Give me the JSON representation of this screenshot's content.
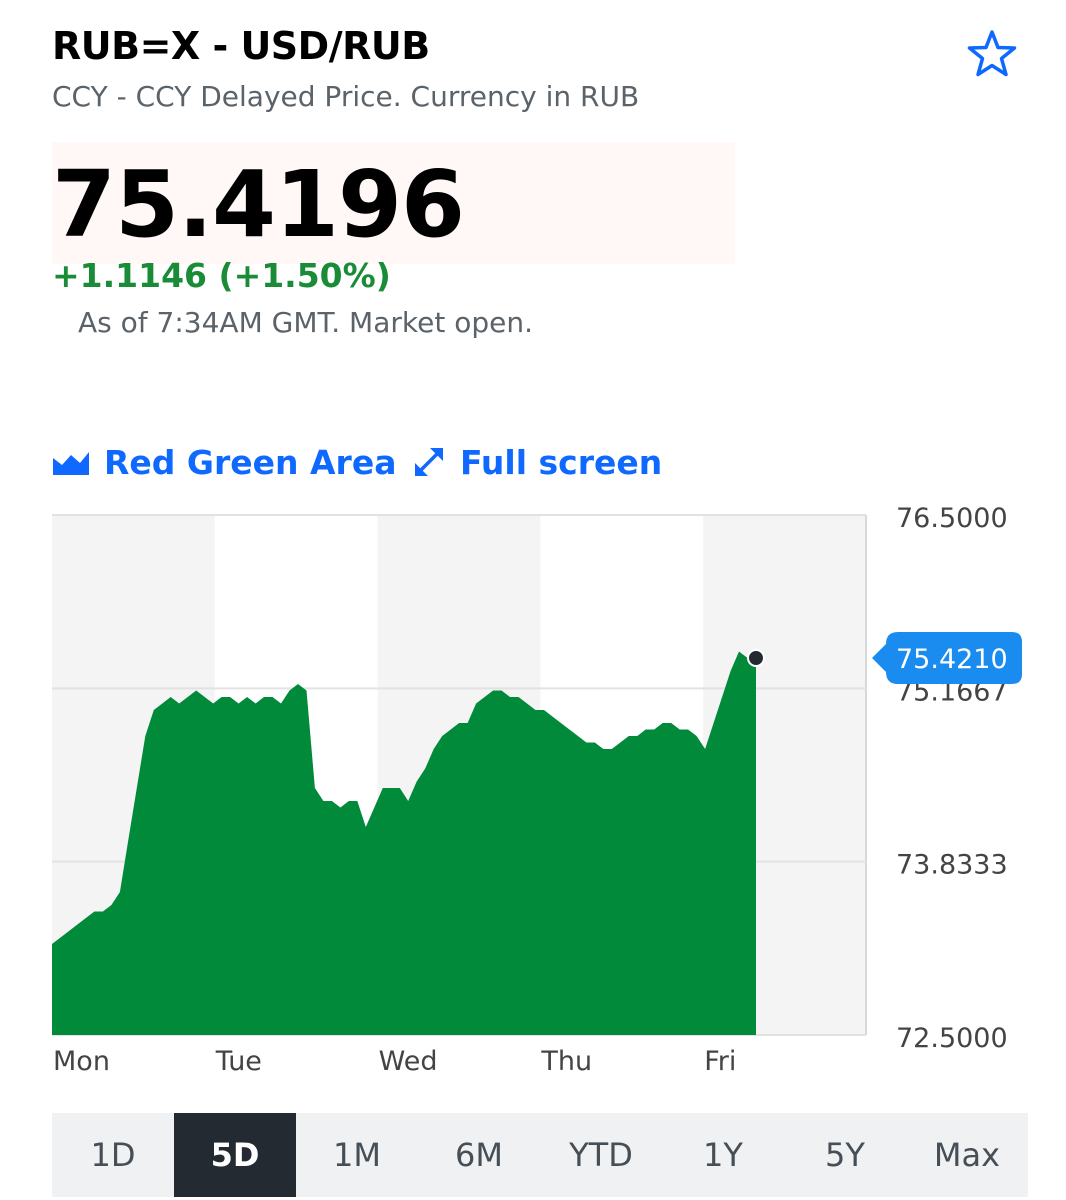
{
  "header": {
    "title": "RUB=X - USD/RUB",
    "subtitle": "CCY - CCY Delayed Price. Currency in RUB",
    "star_icon": "star-outline-icon"
  },
  "quote": {
    "price": "75.4196",
    "change": "+1.1146 (+1.50%)",
    "as_of": "As of 7:34AM GMT. Market open.",
    "change_color": "#1a8c38"
  },
  "toolbar": {
    "chart_type_label": "Red Green Area",
    "chart_type_icon": "area-chart-icon",
    "full_screen_label": "Full screen",
    "full_screen_icon": "expand-icon"
  },
  "chart_data": {
    "type": "area",
    "categories": [
      "Mon",
      "Tue",
      "Wed",
      "Thu",
      "Fri"
    ],
    "y_ticks": [
      "76.5000",
      "75.1667",
      "73.8333",
      "72.5000"
    ],
    "ylim": [
      72.5,
      76.5
    ],
    "current_label": "75.4210",
    "fill_color": "#008a3a",
    "series": [
      {
        "values": [
          73.2,
          73.25,
          73.3,
          73.35,
          73.4,
          73.45,
          73.45,
          73.5,
          73.6,
          74.0,
          74.4,
          74.8,
          75.0,
          75.05,
          75.1,
          75.05,
          75.1,
          75.15,
          75.1,
          75.05,
          75.1,
          75.1,
          75.05,
          75.1,
          75.05,
          75.1,
          75.1,
          75.05,
          75.15,
          75.2,
          75.15,
          74.4,
          74.3,
          74.3,
          74.25,
          74.3,
          74.3,
          74.1,
          74.25,
          74.4,
          74.4,
          74.4,
          74.3,
          74.45,
          74.55,
          74.7,
          74.8,
          74.85,
          74.9,
          74.9,
          75.05,
          75.1,
          75.15,
          75.15,
          75.1,
          75.1,
          75.05,
          75.0,
          75.0,
          74.95,
          74.9,
          74.85,
          74.8,
          74.75,
          74.75,
          74.7,
          74.7,
          74.75,
          74.8,
          74.8,
          74.85,
          74.85,
          74.9,
          74.9,
          74.85,
          74.85,
          74.8,
          74.7,
          74.9,
          75.1,
          75.3,
          75.45,
          75.4,
          75.4
        ],
        "color": "#008a3a"
      }
    ]
  },
  "range_tabs": {
    "items": [
      {
        "label": "1D",
        "active": false
      },
      {
        "label": "5D",
        "active": true
      },
      {
        "label": "1M",
        "active": false
      },
      {
        "label": "6M",
        "active": false
      },
      {
        "label": "YTD",
        "active": false
      },
      {
        "label": "1Y",
        "active": false
      },
      {
        "label": "5Y",
        "active": false
      },
      {
        "label": "Max",
        "active": false
      }
    ]
  }
}
